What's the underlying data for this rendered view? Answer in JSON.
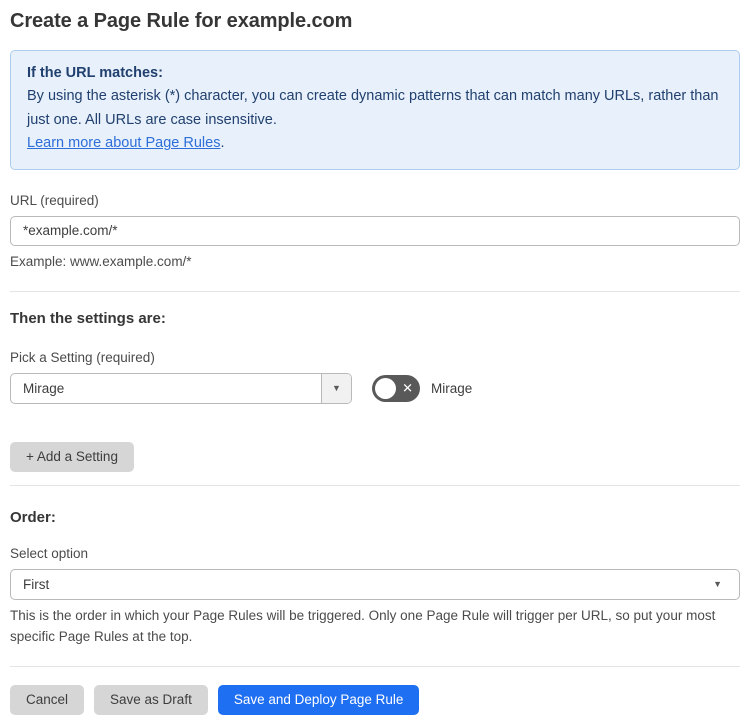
{
  "page": {
    "title": "Create a Page Rule for example.com"
  },
  "info_box": {
    "heading": "If the URL matches:",
    "body": "By using the asterisk (*) character, you can create dynamic patterns that can match many URLs, rather than just one. All URLs are case insensitive.",
    "link_text": "Learn more about Page Rules",
    "link_suffix": "."
  },
  "url_field": {
    "label": "URL (required)",
    "value": "*example.com/*",
    "helper": "Example: www.example.com/*"
  },
  "settings_section": {
    "heading": "Then the settings are:",
    "picker_label": "Pick a Setting (required)",
    "picker_value": "Mirage",
    "toggle_label": "Mirage",
    "toggle_state": "off",
    "add_button_label": "+ Add a Setting"
  },
  "order_section": {
    "heading": "Order:",
    "label": "Select option",
    "value": "First",
    "helper": "This is the order in which your Page Rules will be triggered. Only one Page Rule will trigger per URL, so put your most specific Page Rules at the top."
  },
  "actions": {
    "cancel_label": "Cancel",
    "save_draft_label": "Save as Draft",
    "save_deploy_label": "Save and Deploy Page Rule"
  },
  "icons": {
    "toggle_off_x": "✕",
    "caret_down": "▼"
  },
  "colors": {
    "info_box_bg": "#e8f1fb",
    "info_box_border": "#aecdee",
    "info_text": "#21406f",
    "link": "#2d6ed9",
    "primary_button": "#1f6ff2",
    "gray_button": "#d6d6d6",
    "toggle_off_bg": "#595959"
  }
}
